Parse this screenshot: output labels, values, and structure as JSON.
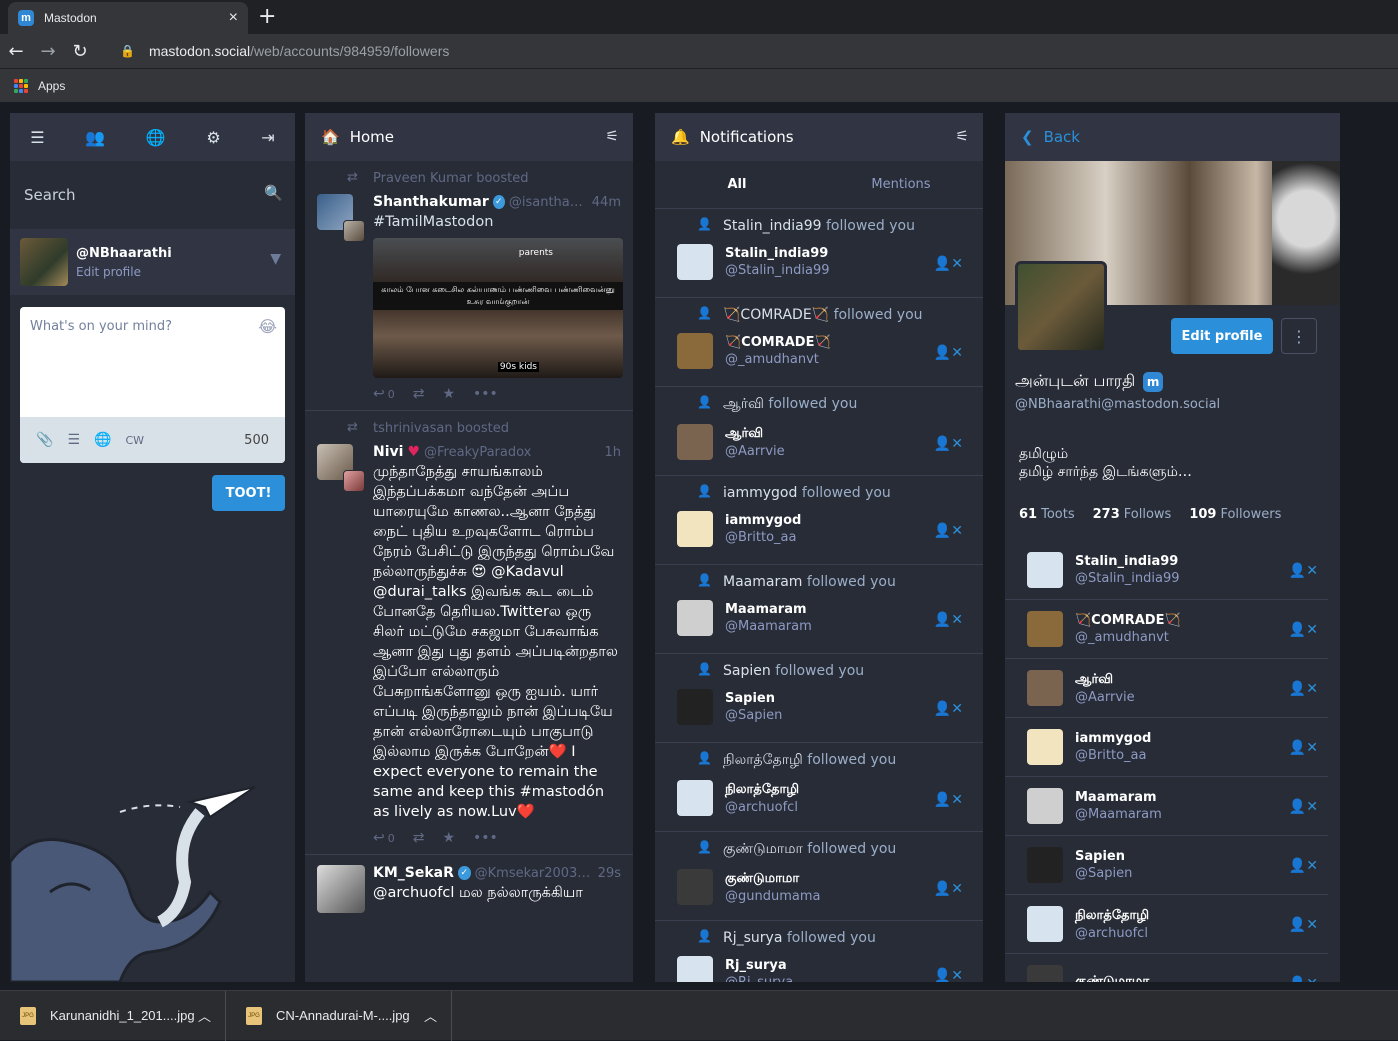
{
  "browser": {
    "tab_title": "Mastodon",
    "url_host": "mastodon.social",
    "url_path": "/web/accounts/984959/followers",
    "bookmark_apps": "Apps"
  },
  "left": {
    "search_placeholder": "Search",
    "handle": "@NBhaarathi",
    "edit_profile": "Edit profile",
    "compose_placeholder": "What's on your mind?",
    "cw": "CW",
    "char_count": "500",
    "toot": "TOOT!"
  },
  "home": {
    "title": "Home",
    "statuses": [
      {
        "boost": "Praveen Kumar boosted",
        "name": "Shanthakumar",
        "acct": "@isanthaku…",
        "time": "44m",
        "text": "#TamilMastodon",
        "media_caption": "காலம் போன கடைசில கல்யாணம் பண்ணிவை பண்ணிவைன்னு உசுர வாங்குறான்",
        "media_top": "parents",
        "media_bottom": "90s kids",
        "reply_count": "0"
      },
      {
        "boost": "tshrinivasan boosted",
        "name": "Nivi",
        "acct": "@FreakyParadox",
        "time": "1h",
        "text": "முந்தாநேத்து சாயங்காலம் இந்தப்பக்கமா வந்தேன் அப்ப யாரையுமே காணல..ஆனா நேத்து நைட் புதிய உறவுகளோட ரொம்ப நேரம் பேசிட்டு இருந்தது ரொம்பவே நல்லாருந்துச்சு 😍 @Kadavul @durai_talks இவங்க கூட டைம் போனதே தெரியல.Twitterல ஒரு சிலர் மட்டுமே சகஜமா பேசுவாங்க ஆனா இது புது தளம் அப்படின்றதால இப்போ எல்லாரும் பேசுறாங்களோனு ஒரு ஐயம். யார் எப்படி இருந்தாலும் நான் இப்படியே தான் எல்லாரோடையும் பாகுபாடு இல்லாம இருக்க போறேன்❤️ I expect everyone to remain the same and keep this #mastodón as lively as now.Luv❤️",
        "reply_count": "0"
      },
      {
        "name": "KM_SekaR",
        "acct": "@Kmsekar2003@…",
        "time": "29s",
        "text": "@archuofcl மல நல்லாருக்கியா"
      }
    ]
  },
  "notifications": {
    "title": "Notifications",
    "tab_all": "All",
    "tab_mentions": "Mentions",
    "followed_you": "followed you",
    "items": [
      {
        "display": "Stalin_india99",
        "acct": "@Stalin_india99",
        "color": "#d7e3ef"
      },
      {
        "display": "🏹COMRADE🏹",
        "acct": "@_amudhanvt",
        "color": "#8a6a3a"
      },
      {
        "display": "ஆர்வி",
        "acct": "@Aarrvie",
        "color": "#7a6450"
      },
      {
        "display": "iammygod",
        "acct": "@Britto_aa",
        "color": "#f3e4c0"
      },
      {
        "display": "Maamaram",
        "acct": "@Maamaram",
        "color": "#cfcfcf"
      },
      {
        "display": "Sapien",
        "acct": "@Sapien",
        "color": "#222222"
      },
      {
        "display": "நிலாத்தோழி",
        "acct": "@archuofcl",
        "color": "#d7e3ef"
      },
      {
        "display": "குண்டுமாமா",
        "acct": "@gundumama",
        "color": "#3a3a3a"
      },
      {
        "display": "Rj_surya",
        "acct": "@Rj_surya",
        "color": "#d7e3ef"
      }
    ]
  },
  "profile": {
    "back": "Back",
    "edit_profile": "Edit profile",
    "display_name": "அன்புடன் பாரதி",
    "acct": "@NBhaarathi@mastodon.social",
    "bio_line1": "தமிழும்",
    "bio_line2": "தமிழ் சார்ந்த இடங்களும்…",
    "toots_count": "61",
    "toots_label": "Toots",
    "follows_count": "273",
    "follows_label": "Follows",
    "followers_count": "109",
    "followers_label": "Followers",
    "followers": [
      {
        "display": "Stalin_india99",
        "acct": "@Stalin_india99",
        "color": "#d7e3ef"
      },
      {
        "display": "🏹COMRADE🏹",
        "acct": "@_amudhanvt",
        "color": "#8a6a3a"
      },
      {
        "display": "ஆர்வி",
        "acct": "@Aarrvie",
        "color": "#7a6450"
      },
      {
        "display": "iammygod",
        "acct": "@Britto_aa",
        "color": "#f3e4c0"
      },
      {
        "display": "Maamaram",
        "acct": "@Maamaram",
        "color": "#cfcfcf"
      },
      {
        "display": "Sapien",
        "acct": "@Sapien",
        "color": "#222222"
      },
      {
        "display": "நிலாத்தோழி",
        "acct": "@archuofcl",
        "color": "#d7e3ef"
      },
      {
        "display": "குண்டுமாமா",
        "acct": "",
        "color": "#3a3a3a"
      }
    ]
  },
  "downloads": [
    {
      "name": "Karunanidhi_1_201....jpg"
    },
    {
      "name": "CN-Annadurai-M-....jpg"
    }
  ],
  "colors": {
    "accent": "#2b90d9",
    "bg": "#191b22",
    "column": "#282c37",
    "header": "#313543"
  }
}
